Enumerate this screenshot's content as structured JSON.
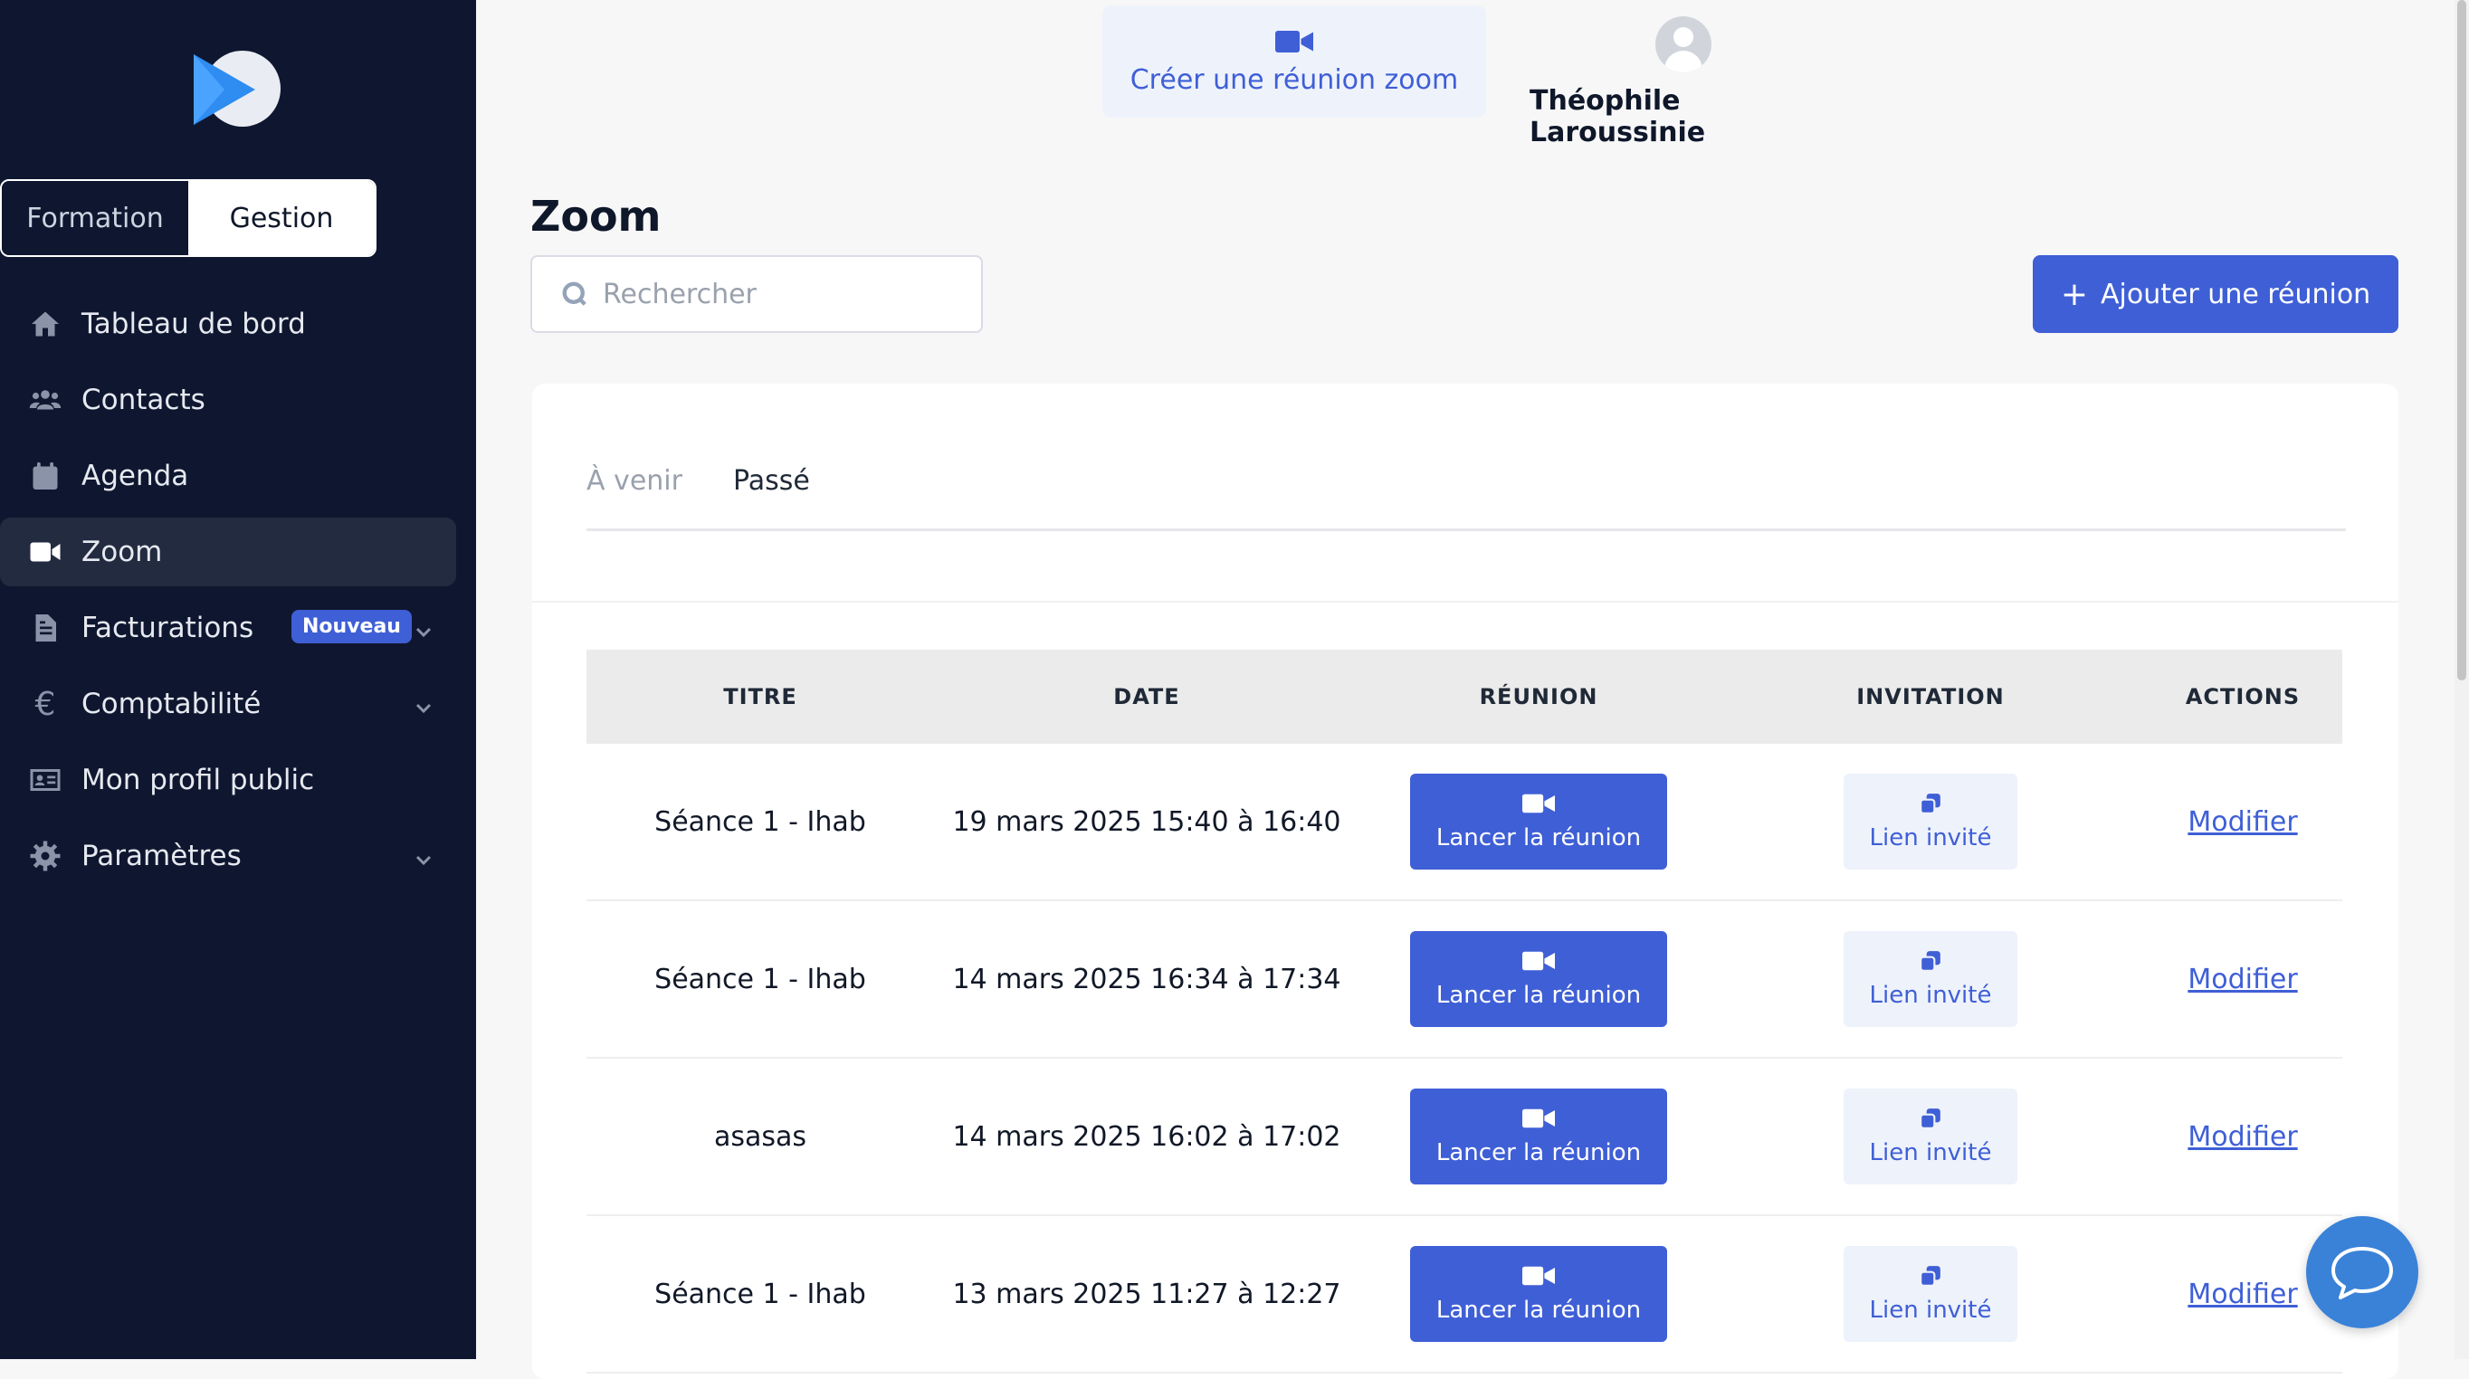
{
  "sidebar": {
    "mode_switch": {
      "formation_label": "Formation",
      "gestion_label": "Gestion",
      "active": "Gestion"
    },
    "items": [
      {
        "label": "Tableau de bord",
        "icon": "home-icon"
      },
      {
        "label": "Contacts",
        "icon": "users-icon"
      },
      {
        "label": "Agenda",
        "icon": "calendar-icon"
      },
      {
        "label": "Zoom",
        "icon": "video-icon",
        "active": true
      },
      {
        "label": "Facturations",
        "icon": "document-icon",
        "badge": "Nouveau",
        "expandable": true
      },
      {
        "label": "Comptabilité",
        "icon": "euro-icon",
        "expandable": true
      },
      {
        "label": "Mon profil public",
        "icon": "id-card-icon"
      },
      {
        "label": "Paramètres",
        "icon": "gear-icon",
        "expandable": true
      }
    ]
  },
  "topbar": {
    "create_zoom_label": "Créer une réunion zoom",
    "user_name": "Théophile Laroussinie"
  },
  "page": {
    "title": "Zoom",
    "search_placeholder": "Rechercher",
    "add_button_label": "Ajouter une réunion"
  },
  "tabs": [
    {
      "label": "À venir",
      "active": false
    },
    {
      "label": "Passé",
      "active": true
    }
  ],
  "table": {
    "headers": [
      "TITRE",
      "DATE",
      "RÉUNION",
      "INVITATION",
      "ACTIONS"
    ],
    "launch_label": "Lancer la réunion",
    "invite_label": "Lien invité",
    "action_label": "Modifier",
    "rows": [
      {
        "title": "Séance 1 - Ihab",
        "date": "19 mars 2025 15:40 à 16:40"
      },
      {
        "title": "Séance 1 - Ihab",
        "date": "14 mars 2025 16:34 à 17:34"
      },
      {
        "title": "asasas",
        "date": "14 mars 2025 16:02 à 17:02"
      },
      {
        "title": "Séance 1 - Ihab",
        "date": "13 mars 2025 11:27 à 12:27"
      }
    ]
  },
  "colors": {
    "sidebar_bg": "#0f1730",
    "accent": "#3f5fd6",
    "chat_button": "#3a82d8"
  }
}
